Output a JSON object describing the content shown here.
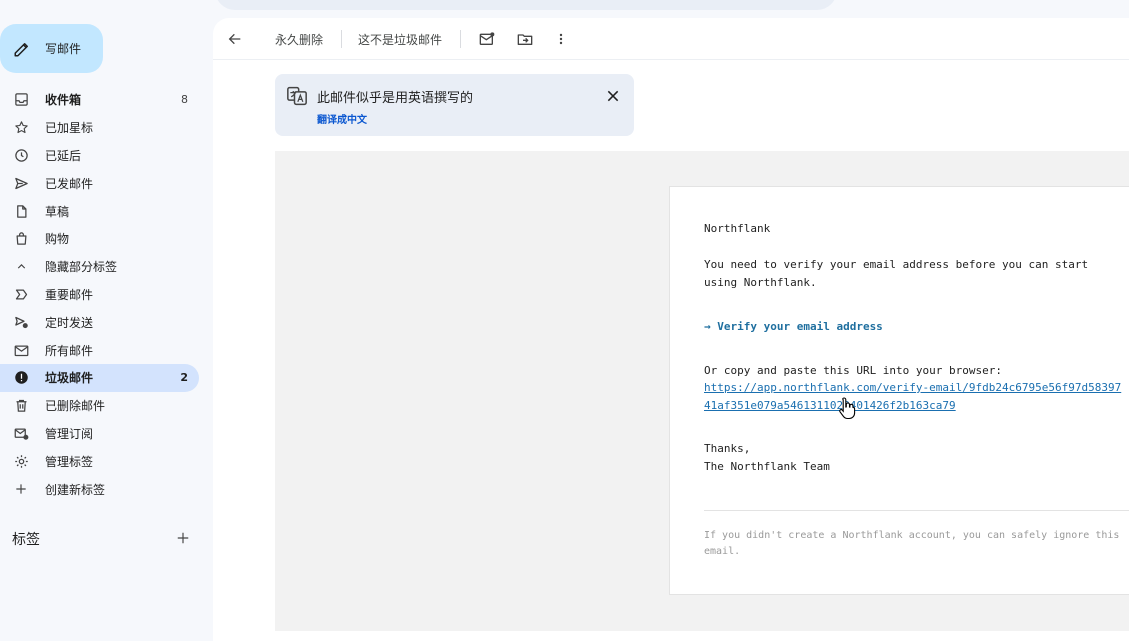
{
  "sidebar": {
    "compose_label": "写邮件",
    "items": [
      {
        "label": "收件箱",
        "count": "8",
        "icon": "inbox-icon"
      },
      {
        "label": "已加星标",
        "count": "",
        "icon": "star-icon"
      },
      {
        "label": "已延后",
        "count": "",
        "icon": "clock-icon"
      },
      {
        "label": "已发邮件",
        "count": "",
        "icon": "send-icon"
      },
      {
        "label": "草稿",
        "count": "",
        "icon": "draft-icon"
      },
      {
        "label": "购物",
        "count": "",
        "icon": "shopping-icon"
      },
      {
        "label": "隐藏部分标签",
        "count": "",
        "icon": "chevron-up-icon"
      },
      {
        "label": "重要邮件",
        "count": "",
        "icon": "important-icon"
      },
      {
        "label": "定时发送",
        "count": "",
        "icon": "scheduled-send-icon"
      },
      {
        "label": "所有邮件",
        "count": "",
        "icon": "all-mail-icon"
      },
      {
        "label": "垃圾邮件",
        "count": "2",
        "icon": "spam-icon"
      },
      {
        "label": "已删除邮件",
        "count": "",
        "icon": "trash-icon"
      },
      {
        "label": "管理订阅",
        "count": "",
        "icon": "subscriptions-icon"
      },
      {
        "label": "管理标签",
        "count": "",
        "icon": "gear-icon"
      },
      {
        "label": "创建新标签",
        "count": "",
        "icon": "plus-icon"
      }
    ],
    "labels_title": "标签"
  },
  "toolbar": {
    "delete_forever": "永久删除",
    "not_spam": "这不是垃圾邮件"
  },
  "translate_bar": {
    "message": "此邮件似乎是用英语撰写的",
    "link": "翻译成中文"
  },
  "email": {
    "sender_line": "Northflank",
    "body_line1": "You need to verify your email address before you can start",
    "body_line2": "using Northflank.",
    "verify_link": "→ Verify your email address",
    "copy_line": "Or copy and paste this URL into your browser:",
    "url_line1": "https://app.northflank.com/verify-email/9fdb24c6795e56f97d58397",
    "url_line2": "41af351e079a5461311028401426f2b163ca79",
    "thanks": "Thanks,",
    "team": "The Northflank Team",
    "footer_line1": "If you didn't create a Northflank account, you can safely ignore this",
    "footer_line2": "email."
  },
  "colors": {
    "compose_bg": "#c2e7ff",
    "active_item_bg": "#d3e3fd",
    "link": "#0b57d0"
  }
}
